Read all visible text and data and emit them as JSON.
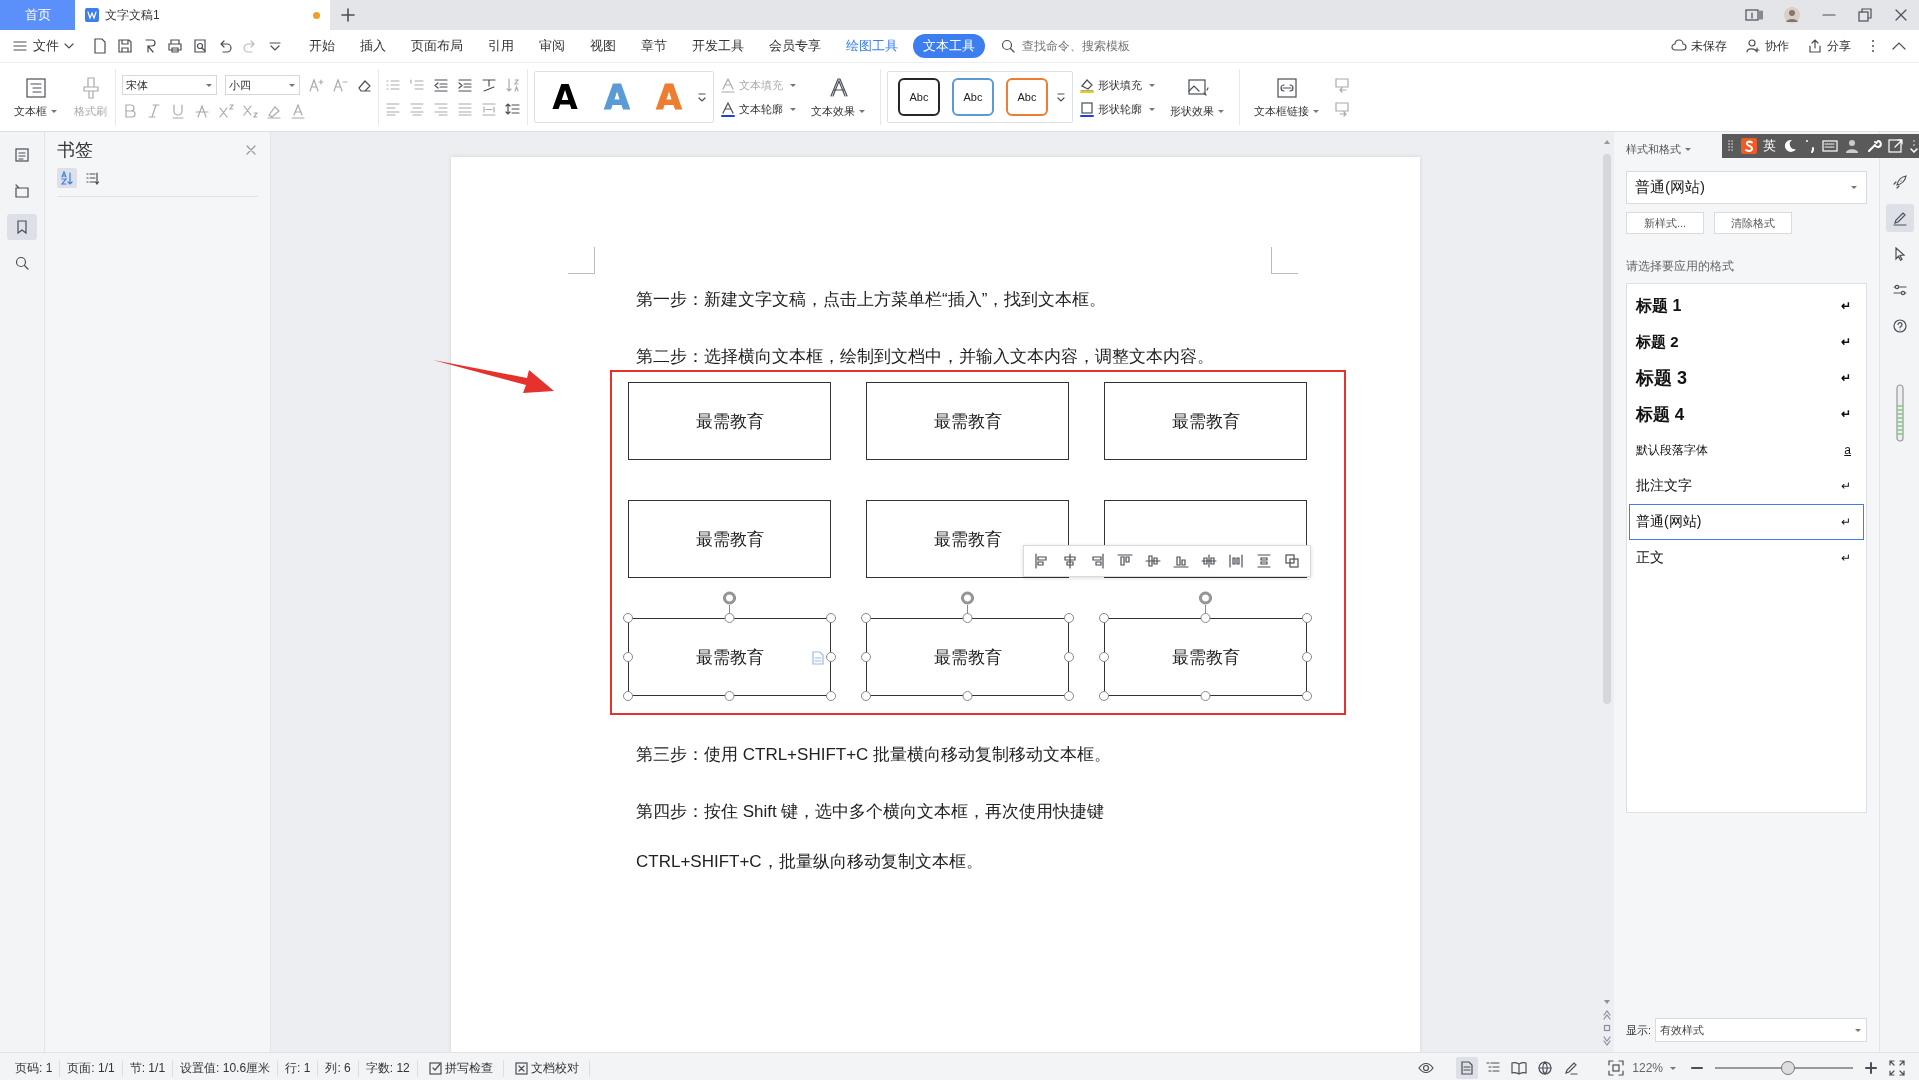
{
  "tabs": [
    {
      "label": "首页",
      "kind": "home"
    },
    {
      "label": "文字文稿1",
      "kind": "document",
      "modified": true
    }
  ],
  "menu": {
    "file": "文件",
    "items": [
      {
        "label": "开始",
        "kind": "normal",
        "selected": false
      },
      {
        "label": "插入",
        "kind": "normal",
        "selected": false
      },
      {
        "label": "页面布局",
        "kind": "normal",
        "selected": false
      },
      {
        "label": "引用",
        "kind": "normal",
        "selected": false
      },
      {
        "label": "审阅",
        "kind": "normal",
        "selected": false
      },
      {
        "label": "视图",
        "kind": "normal",
        "selected": false
      },
      {
        "label": "章节",
        "kind": "normal",
        "selected": false
      },
      {
        "label": "开发工具",
        "kind": "normal",
        "selected": false
      },
      {
        "label": "会员专享",
        "kind": "normal",
        "selected": false
      },
      {
        "label": "绘图工具",
        "kind": "context",
        "selected": false
      },
      {
        "label": "文本工具",
        "kind": "context",
        "selected": true
      }
    ]
  },
  "search": {
    "placeholder": "查找命令、搜索模板"
  },
  "account": [
    {
      "label": "未保存",
      "kind": "cloud"
    },
    {
      "label": "协作",
      "kind": "collab"
    },
    {
      "label": "分享",
      "kind": "share"
    }
  ],
  "ribbon": {
    "textbox": "文本框",
    "format_painter": {
      "label": "格式刷",
      "disabled": true
    },
    "font": "宋体",
    "size": "小四",
    "text_styles": [
      {
        "label": "A",
        "color": "#000000"
      },
      {
        "label": "A",
        "color": "#5b9bd5"
      },
      {
        "label": "A",
        "color": "#ed7d31"
      }
    ],
    "text_fill": {
      "label": "文本填充",
      "disabled": true
    },
    "text_outline": {
      "label": "文本轮廓",
      "disabled": false
    },
    "text_effect": "文本效果",
    "shape_styles": [
      {
        "label": "Abc",
        "color": "#262626"
      },
      {
        "label": "Abc",
        "color": "#5b9bd5"
      },
      {
        "label": "Abc",
        "color": "#ed7d31"
      }
    ],
    "shape_fill": "形状填充",
    "shape_outline": "形状轮廓",
    "shape_effect": "形状效果",
    "textbox_link": "文本框链接"
  },
  "nav": [
    {
      "kind": "outline",
      "selected": false
    },
    {
      "kind": "pages",
      "selected": false
    },
    {
      "kind": "bookmark",
      "selected": true
    },
    {
      "kind": "search",
      "selected": false
    }
  ],
  "sidebar": {
    "title": "书签",
    "sort_modes": [
      {
        "kind": "alpha",
        "selected": true
      },
      {
        "kind": "position",
        "selected": false
      }
    ]
  },
  "document": {
    "before": [
      "第一步：新建文字文稿，点击上方菜单栏“插入”，找到文本框。",
      "第二步：选择横向文本框，绘制到文档中，并输入文本内容，调整文本内容。"
    ],
    "textboxes": [
      {
        "text": "最需教育",
        "selected": false
      },
      {
        "text": "最需教育",
        "selected": false
      },
      {
        "text": "最需教育",
        "selected": false
      },
      {
        "text": "最需教育",
        "selected": false
      },
      {
        "text": "最需教育",
        "selected": false
      },
      {
        "selected": false
      },
      {
        "text": "最需教育",
        "selected": true
      },
      {
        "text": "最需教育",
        "selected": true
      },
      {
        "text": "最需教育",
        "selected": true
      }
    ],
    "after": [
      "第三步：使用 CTRL+SHIFT+C 批量横向移动复制移动文本框。",
      "第四步：按住 Shift 键，选中多个横向文本框，再次使用快捷键 CTRL+SHIFT+C，批量纵向移动复制文本框。"
    ]
  },
  "ime": {
    "mode": "英"
  },
  "styles_panel": {
    "title": "样式和格式",
    "current": "普通(网站)",
    "buttons": [
      "新样式...",
      "清除格式"
    ],
    "hint": "请选择要应用的格式",
    "styles": [
      {
        "label": "标题 1",
        "kind": "heading1",
        "marker": "↵",
        "selected": false
      },
      {
        "label": "标题 2",
        "kind": "heading2",
        "marker": "↵",
        "selected": false
      },
      {
        "label": "标题 3",
        "kind": "heading3",
        "marker": "↵",
        "selected": false
      },
      {
        "label": "标题 4",
        "kind": "heading4",
        "marker": "↵",
        "selected": false
      },
      {
        "label": "默认段落字体",
        "kind": "character",
        "marker": "a",
        "selected": false
      },
      {
        "label": "批注文字",
        "kind": "normal",
        "marker": "↵",
        "selected": false
      },
      {
        "label": "普通(网站)",
        "kind": "normal",
        "marker": "↵",
        "selected": true
      },
      {
        "label": "正文",
        "kind": "normal",
        "marker": "↵",
        "selected": false
      }
    ],
    "show_label": "显示:",
    "show_value": "有效样式"
  },
  "side_tools": [
    {
      "kind": "rocket",
      "selected": false
    },
    {
      "kind": "pen",
      "selected": true
    },
    {
      "kind": "cursor",
      "selected": false
    },
    {
      "kind": "sliders",
      "selected": false
    },
    {
      "kind": "help",
      "selected": false
    }
  ],
  "status_bar": {
    "items": [
      "页码: 1",
      "页面: 1/1",
      "节: 1/1",
      "设置值: 10.6厘米",
      "行: 1",
      "列: 6",
      "字数: 12"
    ],
    "checks": [
      {
        "label": "拼写检查",
        "kind": "spell"
      },
      {
        "label": "文档校对",
        "kind": "proof"
      }
    ],
    "views": [
      {
        "kind": "page",
        "selected": true
      },
      {
        "kind": "outline",
        "selected": false
      },
      {
        "kind": "reading",
        "selected": false
      },
      {
        "kind": "web",
        "selected": false
      },
      {
        "kind": "write",
        "selected": false
      }
    ],
    "zoom": "122%",
    "zoom_slider": {
      "level": 0.53
    }
  }
}
